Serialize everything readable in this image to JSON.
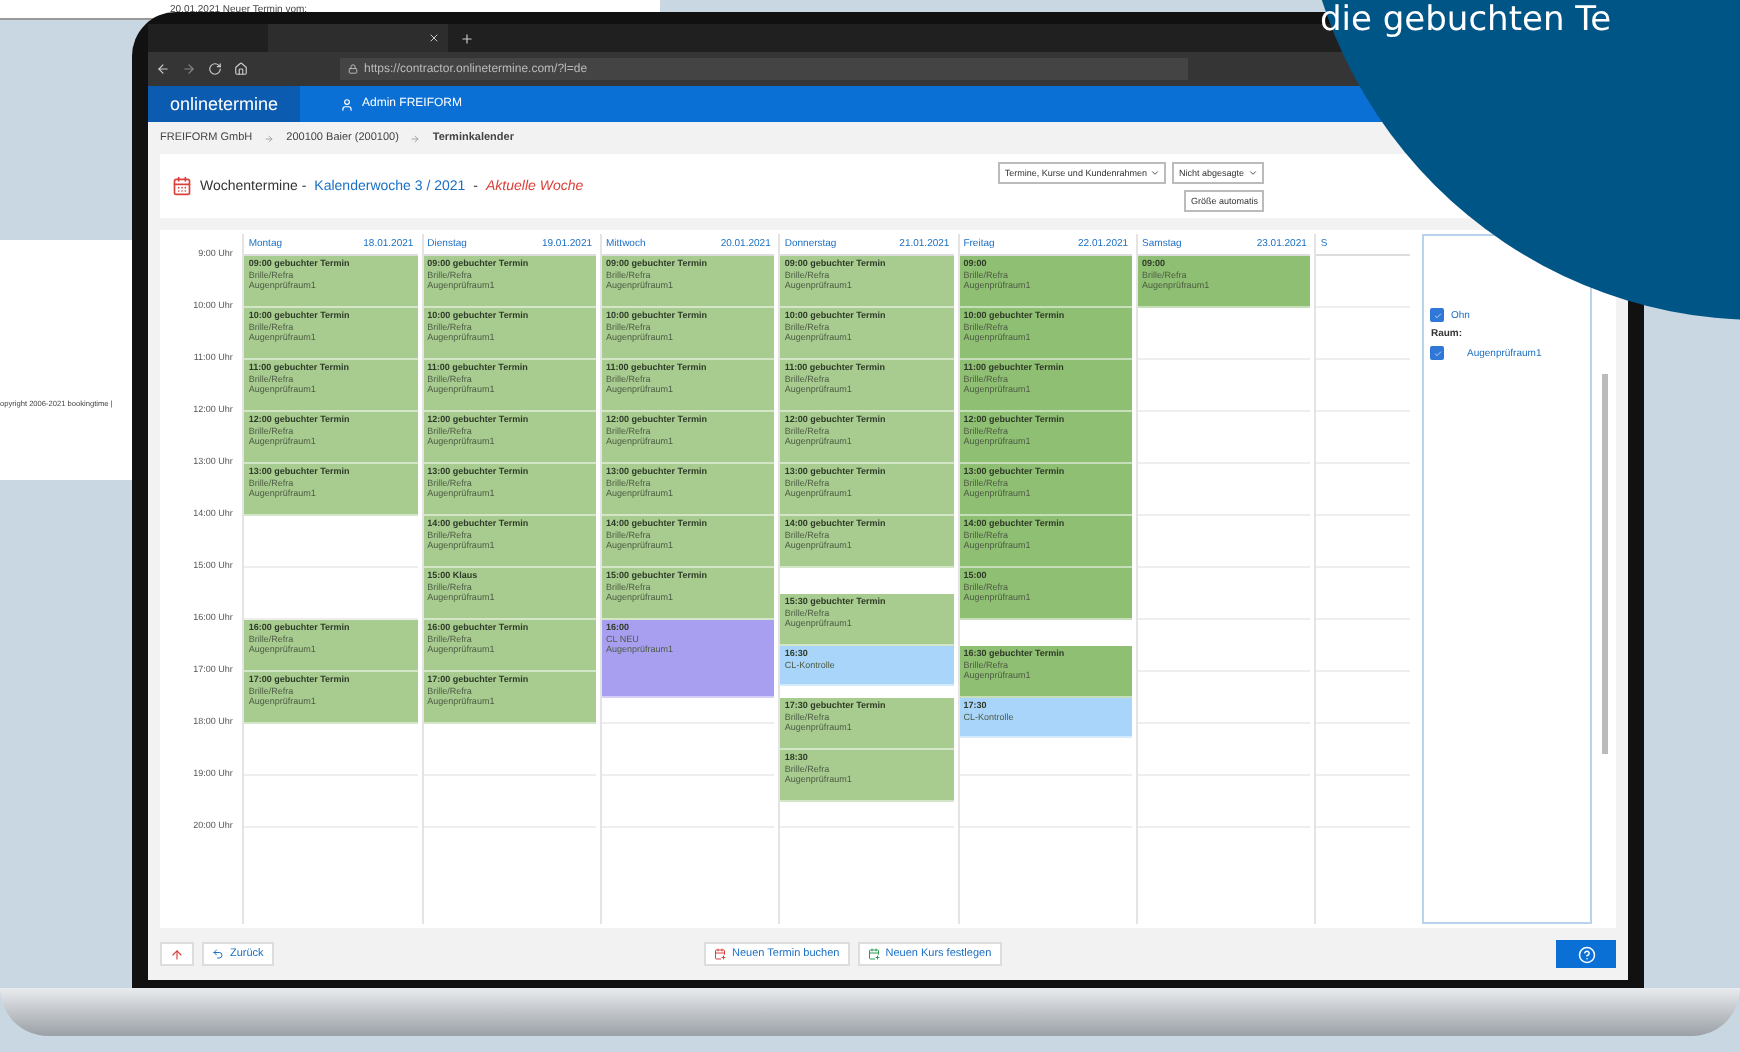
{
  "background_windows": {
    "top_line": "20.01.2021 Neuer Termin vom:",
    "copyright": "opyright 2006-2021 bookingtime |"
  },
  "browser": {
    "url": "https://contractor.onlinetermine.com/?l=de"
  },
  "app_header": {
    "logo": "onlinetermine",
    "user": "Admin FREIFORM"
  },
  "breadcrumb": [
    {
      "label": "FREIFORM GmbH",
      "current": false
    },
    {
      "label": "200100 Baier (200100)",
      "current": false
    },
    {
      "label": "Terminkalender",
      "current": true
    }
  ],
  "title": {
    "prefix": "Wochentermine -",
    "week": "Kalenderwoche 3 / 2021",
    "separator": "-",
    "current": "Aktuelle Woche"
  },
  "filters": [
    {
      "kind": "select",
      "value": "Termine, Kurse und Kundenrahmen"
    },
    {
      "kind": "select",
      "value": "Nicht abgesagte"
    },
    {
      "kind": "button",
      "value": "Größe automatis"
    }
  ],
  "hours": [
    "9:00 Uhr",
    "10:00 Uhr",
    "11:00 Uhr",
    "12:00 Uhr",
    "13:00 Uhr",
    "14:00 Uhr",
    "15:00 Uhr",
    "16:00 Uhr",
    "17:00 Uhr",
    "18:00 Uhr",
    "19:00 Uhr",
    "20:00 Uhr"
  ],
  "days": [
    {
      "name": "Montag",
      "date": "18.01.2021",
      "events": [
        {
          "kind": "slot",
          "color": "#a8cc90",
          "title": "09:00 gebuchter Termin",
          "lines": [
            "Brille/Refra",
            "Augenprüfraum1"
          ]
        },
        {
          "kind": "slot",
          "color": "#a8cc90",
          "title": "10:00 gebuchter Termin",
          "lines": [
            "Brille/Refra",
            "Augenprüfraum1"
          ]
        },
        {
          "kind": "slot",
          "color": "#a8cc90",
          "title": "11:00 gebuchter Termin",
          "lines": [
            "Brille/Refra",
            "Augenprüfraum1"
          ]
        },
        {
          "kind": "slot",
          "color": "#a8cc90",
          "title": "12:00 gebuchter Termin",
          "lines": [
            "Brille/Refra",
            "Augenprüfraum1"
          ]
        },
        {
          "kind": "slot",
          "color": "#a8cc90",
          "title": "13:00 gebuchter Termin",
          "lines": [
            "Brille/Refra",
            "Augenprüfraum1"
          ]
        },
        {
          "kind": "gap"
        },
        {
          "kind": "gap"
        },
        {
          "kind": "gap"
        },
        {
          "kind": "gap"
        },
        {
          "kind": "slot",
          "color": "#a8cc90",
          "title": "16:00 gebuchter Termin",
          "lines": [
            "Brille/Refra",
            "Augenprüfraum1"
          ]
        },
        {
          "kind": "slot",
          "color": "#a8cc90",
          "title": "17:00 gebuchter Termin",
          "lines": [
            "Brille/Refra",
            "Augenprüfraum1"
          ]
        }
      ]
    },
    {
      "name": "Dienstag",
      "date": "19.01.2021",
      "events": [
        {
          "kind": "slot",
          "color": "#a8cc90",
          "title": "09:00 gebuchter Termin",
          "lines": [
            "Brille/Refra",
            "Augenprüfraum1"
          ]
        },
        {
          "kind": "slot",
          "color": "#a8cc90",
          "title": "10:00 gebuchter Termin",
          "lines": [
            "Brille/Refra",
            "Augenprüfraum1"
          ]
        },
        {
          "kind": "slot",
          "color": "#a8cc90",
          "title": "11:00 gebuchter Termin",
          "lines": [
            "Brille/Refra",
            "Augenprüfraum1"
          ]
        },
        {
          "kind": "slot",
          "color": "#a8cc90",
          "title": "12:00 gebuchter Termin",
          "lines": [
            "Brille/Refra",
            "Augenprüfraum1"
          ]
        },
        {
          "kind": "slot",
          "color": "#a8cc90",
          "title": "13:00 gebuchter Termin",
          "lines": [
            "Brille/Refra",
            "Augenprüfraum1"
          ]
        },
        {
          "kind": "slot",
          "color": "#a8cc90",
          "title": "14:00 gebuchter Termin",
          "lines": [
            "Brille/Refra",
            "Augenprüfraum1"
          ]
        },
        {
          "kind": "slot",
          "color": "#a8cc90",
          "title": "15:00 Klaus",
          "lines": [
            "Brille/Refra",
            "Augenprüfraum1"
          ]
        },
        {
          "kind": "slot",
          "color": "#a8cc90",
          "title": "16:00 gebuchter Termin",
          "lines": [
            "Brille/Refra",
            "Augenprüfraum1"
          ]
        },
        {
          "kind": "slot",
          "color": "#a8cc90",
          "title": "17:00 gebuchter Termin",
          "lines": [
            "Brille/Refra",
            "Augenprüfraum1"
          ]
        }
      ]
    },
    {
      "name": "Mittwoch",
      "date": "20.01.2021",
      "events": [
        {
          "kind": "slot",
          "color": "#a8cc90",
          "title": "09:00 gebuchter Termin",
          "lines": [
            "Brille/Refra",
            "Augenprüfraum1"
          ]
        },
        {
          "kind": "slot",
          "color": "#a8cc90",
          "title": "10:00 gebuchter Termin",
          "lines": [
            "Brille/Refra",
            "Augenprüfraum1"
          ]
        },
        {
          "kind": "slot",
          "color": "#a8cc90",
          "title": "11:00 gebuchter Termin",
          "lines": [
            "Brille/Refra",
            "Augenprüfraum1"
          ]
        },
        {
          "kind": "slot",
          "color": "#a8cc90",
          "title": "12:00 gebuchter Termin",
          "lines": [
            "Brille/Refra",
            "Augenprüfraum1"
          ]
        },
        {
          "kind": "slot",
          "color": "#a8cc90",
          "title": "13:00 gebuchter Termin",
          "lines": [
            "Brille/Refra",
            "Augenprüfraum1"
          ]
        },
        {
          "kind": "slot",
          "color": "#a8cc90",
          "title": "14:00 gebuchter Termin",
          "lines": [
            "Brille/Refra",
            "Augenprüfraum1"
          ]
        },
        {
          "kind": "slot",
          "color": "#a8cc90",
          "title": "15:00 gebuchter Termin",
          "lines": [
            "Brille/Refra",
            "Augenprüfraum1"
          ]
        },
        {
          "kind": "extended",
          "color": "#a99ff0",
          "title": "16:00",
          "lines": [
            "CL NEU",
            "Augenprüfraum1"
          ]
        }
      ]
    },
    {
      "name": "Donnerstag",
      "date": "21.01.2021",
      "events": [
        {
          "kind": "slot",
          "color": "#a8cc90",
          "title": "09:00 gebuchter Termin",
          "lines": [
            "Brille/Refra",
            "Augenprüfraum1"
          ]
        },
        {
          "kind": "slot",
          "color": "#a8cc90",
          "title": "10:00 gebuchter Termin",
          "lines": [
            "Brille/Refra",
            "Augenprüfraum1"
          ]
        },
        {
          "kind": "slot",
          "color": "#a8cc90",
          "title": "11:00 gebuchter Termin",
          "lines": [
            "Brille/Refra",
            "Augenprüfraum1"
          ]
        },
        {
          "kind": "slot",
          "color": "#a8cc90",
          "title": "12:00 gebuchter Termin",
          "lines": [
            "Brille/Refra",
            "Augenprüfraum1"
          ]
        },
        {
          "kind": "slot",
          "color": "#a8cc90",
          "title": "13:00 gebuchter Termin",
          "lines": [
            "Brille/Refra",
            "Augenprüfraum1"
          ]
        },
        {
          "kind": "slot",
          "color": "#a8cc90",
          "title": "14:00 gebuchter Termin",
          "lines": [
            "Brille/Refra",
            "Augenprüfraum1"
          ]
        },
        {
          "kind": "gap"
        },
        {
          "kind": "slot",
          "color": "#a8cc90",
          "title": "15:30 gebuchter Termin",
          "lines": [
            "Brille/Refra",
            "Augenprüfraum1"
          ]
        },
        {
          "kind": "brief",
          "color": "#a9d5fb",
          "title": "16:30",
          "lines": [
            "CL-Kontrolle"
          ]
        },
        {
          "kind": "slot",
          "color": "#a8cc90",
          "title": "17:30 gebuchter Termin",
          "lines": [
            "Brille/Refra",
            "Augenprüfraum1"
          ]
        },
        {
          "kind": "slot",
          "color": "#a8cc90",
          "title": "18:30",
          "lines": [
            "Brille/Refra",
            "Augenprüfraum1"
          ]
        }
      ]
    },
    {
      "name": "Freitag",
      "date": "22.01.2021",
      "events": [
        {
          "kind": "slot",
          "color": "#8fbf72",
          "title": "09:00",
          "lines": [
            "Brille/Refra",
            "Augenprüfraum1"
          ]
        },
        {
          "kind": "slot",
          "color": "#8fbf72",
          "title": "10:00 gebuchter Termin",
          "lines": [
            "Brille/Refra",
            "Augenprüfraum1"
          ]
        },
        {
          "kind": "slot",
          "color": "#8fbf72",
          "title": "11:00 gebuchter Termin",
          "lines": [
            "Brille/Refra",
            "Augenprüfraum1"
          ]
        },
        {
          "kind": "slot",
          "color": "#8fbf72",
          "title": "12:00 gebuchter Termin",
          "lines": [
            "Brille/Refra",
            "Augenprüfraum1"
          ]
        },
        {
          "kind": "slot",
          "color": "#8fbf72",
          "title": "13:00 gebuchter Termin",
          "lines": [
            "Brille/Refra",
            "Augenprüfraum1"
          ]
        },
        {
          "kind": "slot",
          "color": "#8fbf72",
          "title": "14:00 gebuchter Termin",
          "lines": [
            "Brille/Refra",
            "Augenprüfraum1"
          ]
        },
        {
          "kind": "slot",
          "color": "#8fbf72",
          "title": "15:00",
          "lines": [
            "Brille/Refra",
            "Augenprüfraum1"
          ]
        },
        {
          "kind": "gap"
        },
        {
          "kind": "slot",
          "color": "#8fbf72",
          "title": "16:30 gebuchter Termin",
          "lines": [
            "Brille/Refra",
            "Augenprüfraum1"
          ]
        },
        {
          "kind": "brief",
          "color": "#a9d5fb",
          "title": "17:30",
          "lines": [
            "CL-Kontrolle"
          ]
        }
      ]
    },
    {
      "name": "Samstag",
      "date": "23.01.2021",
      "events": [
        {
          "kind": "slot",
          "color": "#8fbf72",
          "title": "09:00",
          "lines": [
            "Brille/Refra",
            "Augenprüfraum1"
          ]
        }
      ]
    },
    {
      "name": "S"
    }
  ],
  "side_panel": {
    "options": [
      {
        "label": "Ohn",
        "checked": true
      }
    ],
    "room_heading": "Raum:",
    "rooms": [
      {
        "label": "Augenprüfraum1",
        "checked": true
      }
    ]
  },
  "footer": {
    "back": "Zurück",
    "actions": [
      "Neuen Termin buchen",
      "Neuen Kurs festlegen"
    ]
  },
  "promo": {
    "text": "die gebuchten Te"
  }
}
